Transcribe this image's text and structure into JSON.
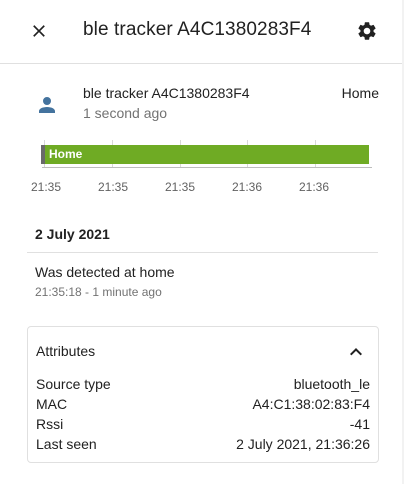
{
  "dialog": {
    "title": "ble tracker A4C1380283F4",
    "close_icon": "close-icon",
    "settings_icon": "gear-icon"
  },
  "entity": {
    "icon": "account-icon",
    "icon_color": "#44739e",
    "name": "ble tracker A4C1380283F4",
    "last_changed": "1 second ago",
    "state": "Home"
  },
  "timeline": {
    "bar_label": "Home",
    "bar_color": "#6fab24",
    "ticks": [
      "21:35",
      "21:35",
      "21:35",
      "21:36",
      "21:36"
    ]
  },
  "logbook": {
    "date": "2 July 2021",
    "entries": [
      {
        "message": "Was detected at home",
        "time": "21:35:18 - 1 minute ago"
      }
    ]
  },
  "attributes": {
    "title": "Attributes",
    "toggle_icon": "chevron-up-icon",
    "rows": [
      {
        "key": "Source type",
        "value": "bluetooth_le"
      },
      {
        "key": "MAC",
        "value": "A4:C1:38:02:83:F4"
      },
      {
        "key": "Rssi",
        "value": "-41"
      },
      {
        "key": "Last seen",
        "value": "2 July 2021, 21:36:26"
      }
    ]
  }
}
